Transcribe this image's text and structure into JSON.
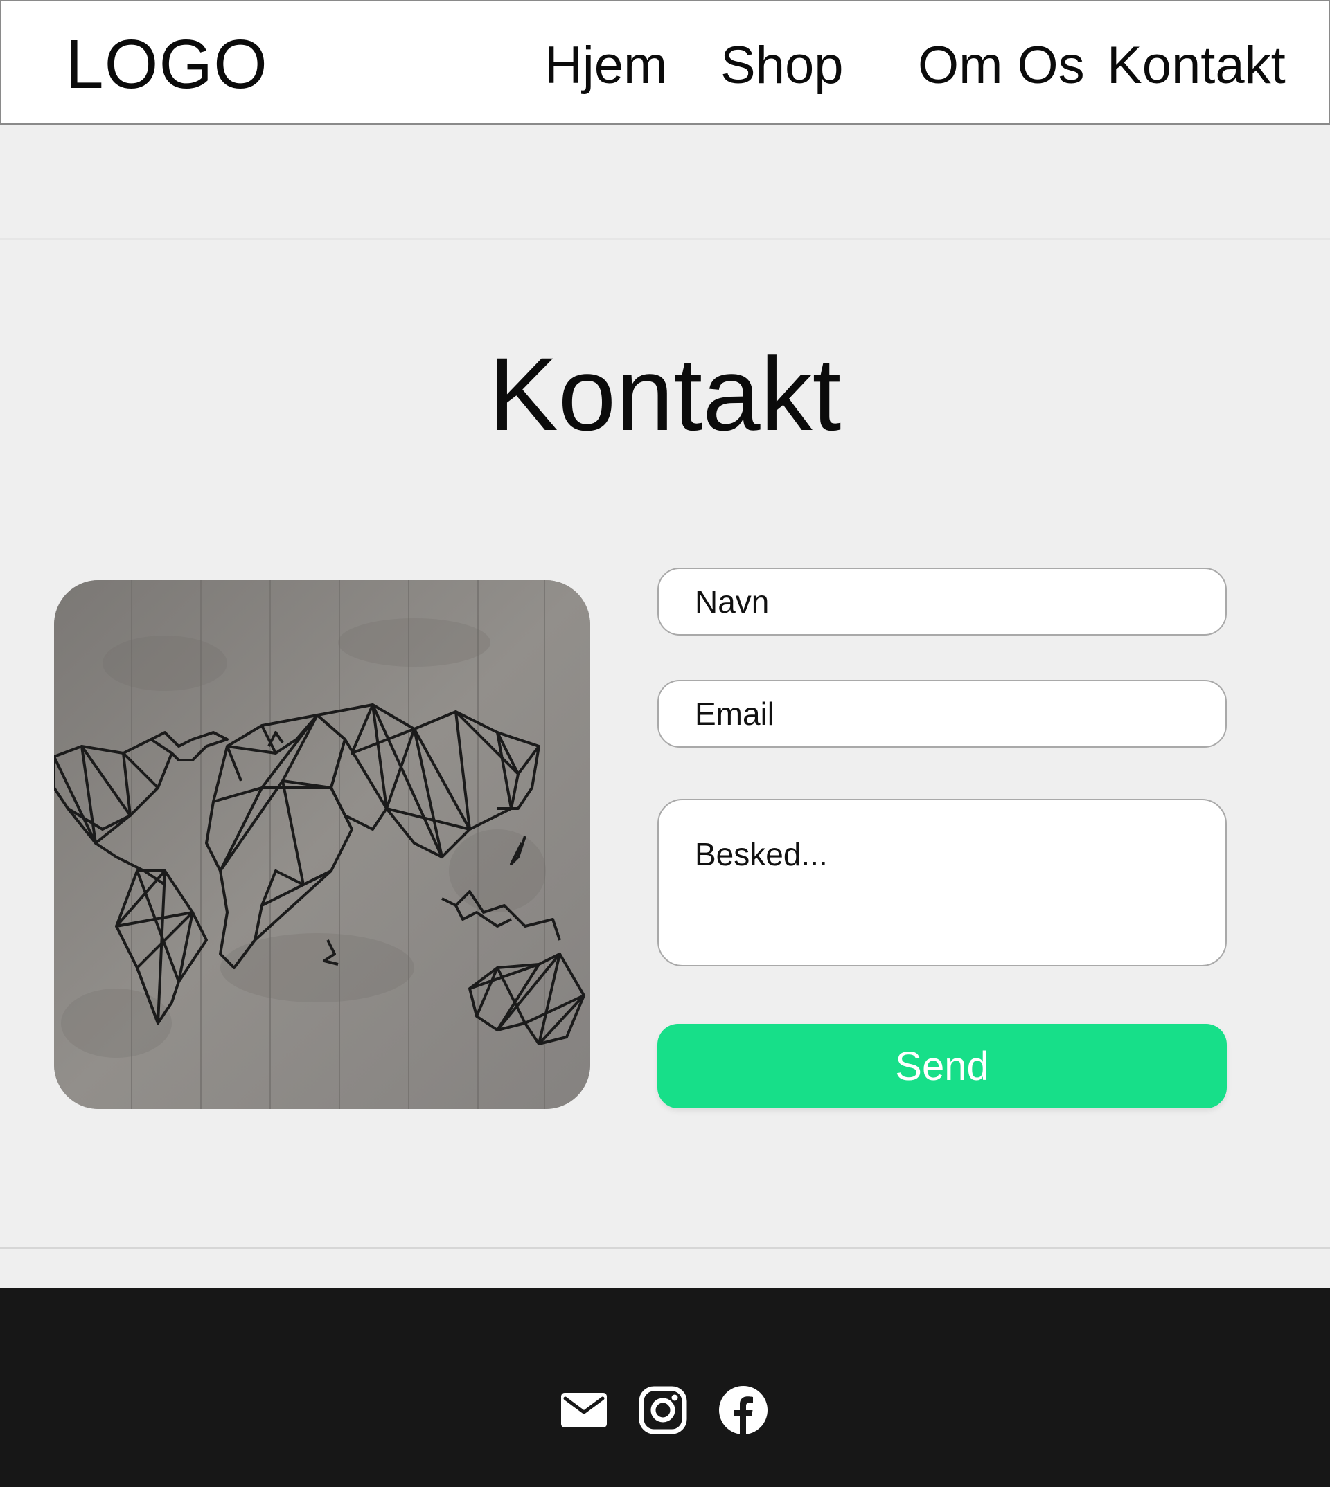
{
  "header": {
    "logo": "LOGO",
    "nav": {
      "home": "Hjem",
      "shop": "Shop",
      "about": "Om Os",
      "contact": "Kontakt"
    }
  },
  "main": {
    "title": "Kontakt",
    "form": {
      "name_placeholder": "Navn",
      "email_placeholder": "Email",
      "message_placeholder": "Besked...",
      "submit_label": "Send"
    }
  },
  "footer": {
    "icons": [
      "mail-icon",
      "instagram-icon",
      "facebook-icon"
    ]
  },
  "colors": {
    "page_background": "#efefef",
    "header_background": "#ffffff",
    "send_button": "#17df89",
    "footer_background": "#171717"
  }
}
